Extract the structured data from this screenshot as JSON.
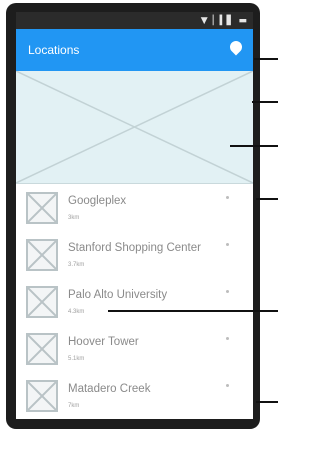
{
  "status_bar": {
    "icons": [
      "wifi-icon",
      "signal-icon",
      "battery-icon"
    ]
  },
  "app_bar": {
    "title": "Locations",
    "action_icon": "map-pin-icon",
    "color": "#2196f3"
  },
  "map": {
    "placeholder": "image-placeholder"
  },
  "locations": [
    {
      "name": "Googleplex",
      "distance": "3km"
    },
    {
      "name": "Stanford Shopping Center",
      "distance": "3.7km"
    },
    {
      "name": "Palo Alto University",
      "distance": "4.3km"
    },
    {
      "name": "Hoover Tower",
      "distance": "5.1km"
    },
    {
      "name": "Matadero Creek",
      "distance": "7km"
    }
  ]
}
